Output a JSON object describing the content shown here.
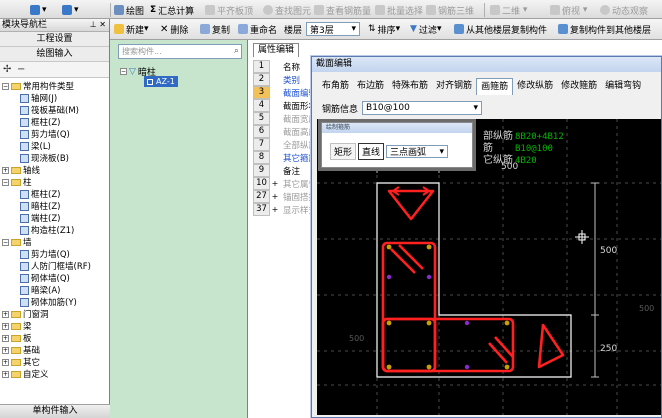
{
  "toolbar1": {
    "draw": "绘图",
    "sum": "汇总计算",
    "flat_view": "平齐板顶",
    "find_elem": "查找图元",
    "view_rebar": "查看钢筋量",
    "batch_select": "批量选择",
    "rebar_3d": "钢筋三维",
    "view_mode": "二维",
    "top_view": "俯视",
    "dynamic_view": "动态观察"
  },
  "toolbar2": {
    "new": "新建",
    "delete": "删除",
    "copy": "复制",
    "rename": "重命名",
    "floor_label": "楼层",
    "floor_value": "第3层",
    "sort": "排序",
    "filter": "过滤",
    "copy_from_floor": "从其他楼层复制构件",
    "copy_to_floor": "复制构件到其他楼层"
  },
  "nav": {
    "title": "模块导航栏",
    "project_settings": "工程设置",
    "drawing_input": "绘图输入",
    "footer": "单构件输入",
    "tree": {
      "common": "常用构件类型",
      "axis_grid": "轴网(J)",
      "raft": "筏板基础(M)",
      "frame_col": "框柱(Z)",
      "shear_wall_c": "剪力墙(Q)",
      "beam_c": "梁(L)",
      "slab_c": "现浇板(B)",
      "axis_line": "轴线",
      "column": "柱",
      "frame_col2": "框柱(Z)",
      "hidden_col": "暗柱(Z)",
      "end_col": "端柱(Z)",
      "struct_col": "构造柱(Z1)",
      "wall": "墙",
      "shear_wall": "剪力墙(Q)",
      "civil_door": "人防门框墙(RF)",
      "masonry_wall": "砌体墙(Q)",
      "hidden_beam": "暗梁(A)",
      "masonry_rebar": "砌体加筋(Y)",
      "openings": "门窗洞",
      "beam": "梁",
      "slab": "板",
      "foundation": "基础",
      "other": "其它",
      "custom": "自定义"
    }
  },
  "component": {
    "search_placeholder": "搜索构件...",
    "group": "暗柱",
    "selected": "AZ-1"
  },
  "props": {
    "tab": "属性编辑",
    "rows": [
      {
        "n": "1",
        "label": "名称"
      },
      {
        "n": "2",
        "label": "类别"
      },
      {
        "n": "3",
        "label": "截面编辑"
      },
      {
        "n": "4",
        "label": "截面形状"
      },
      {
        "n": "5",
        "label": "截面宽度"
      },
      {
        "n": "6",
        "label": "截面高度"
      },
      {
        "n": "7",
        "label": "全部纵筋"
      },
      {
        "n": "8",
        "label": "其它箍筋"
      },
      {
        "n": "9",
        "label": "备注"
      },
      {
        "n": "10",
        "label": "其它属性"
      },
      {
        "n": "27",
        "label": "锚固搭接"
      },
      {
        "n": "37",
        "label": "显示样式"
      }
    ]
  },
  "dialog": {
    "title": "截面编辑",
    "tabs": [
      "布角筋",
      "布边筋",
      "特殊布筋",
      "对齐钢筋",
      "画箍筋",
      "修改纵筋",
      "修改箍筋",
      "编辑弯钩"
    ],
    "active_tab": "画箍筋",
    "rebar_info_label": "钢筋信息",
    "rebar_info_value": "B10@100",
    "popup": {
      "title": "绘制箍筋",
      "rect": "矩形",
      "line": "直线",
      "arc": "三点画弧"
    },
    "canvas": {
      "info_labels": [
        "部纵筋",
        "筋",
        "它纵筋"
      ],
      "info_values": [
        "8B20+4B12",
        "B10@100",
        "4B20"
      ],
      "dim_top": "500",
      "dim_right": "500",
      "dim_bottom": "250",
      "dim_left_faint": "500",
      "dim_right_faint": "500"
    }
  },
  "colors": {
    "selection": "#316ac5",
    "component_bg": "#c6e5cc",
    "rebar": "#ff2020",
    "info_green": "#00b400",
    "canvas_bg": "#000000"
  }
}
